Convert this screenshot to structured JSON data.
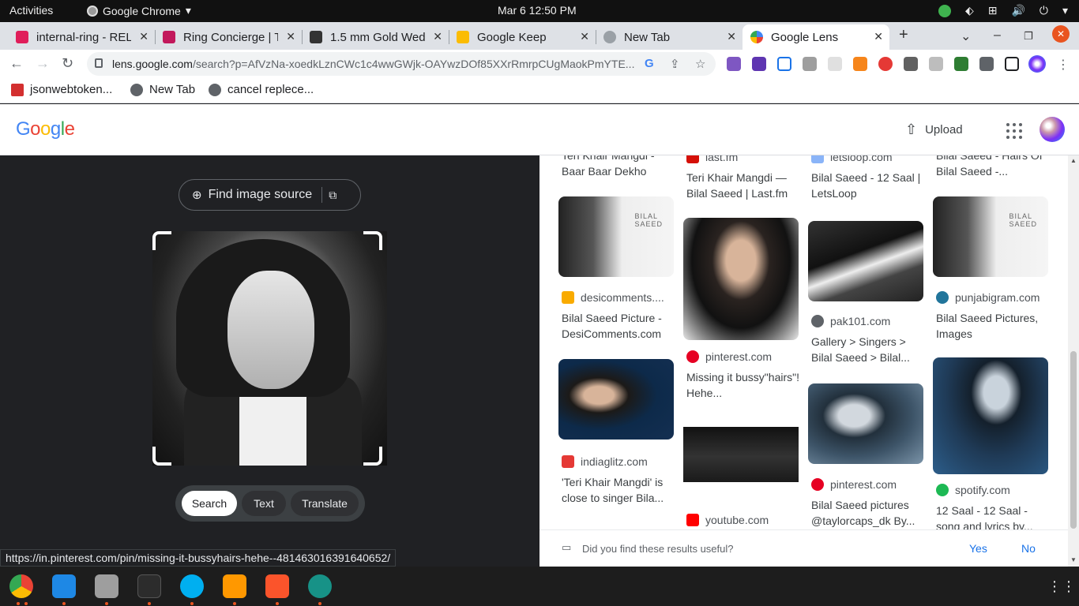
{
  "system": {
    "activities": "Activities",
    "app_name": "Google Chrome",
    "clock": "Mar 6  12:50 PM"
  },
  "tabs": [
    {
      "title": "internal-ring - REL",
      "favicon_color": "#e01e5a"
    },
    {
      "title": "Ring Concierge | T",
      "favicon_color": "#c2185b"
    },
    {
      "title": "1.5 mm Gold Wed",
      "favicon_color": "#333333"
    },
    {
      "title": "Google Keep",
      "favicon_color": "#fbbc04"
    },
    {
      "title": "New Tab",
      "favicon_color": "#9aa0a6"
    },
    {
      "title": "Google Lens",
      "favicon_color": "#4285f4",
      "active": true
    }
  ],
  "toolbar": {
    "url_host": "lens.google.com",
    "url_rest": "/search?p=AfVzNa-xoedkLznCWc1c4wwGWjk-OAYwzDOf85XXrRmrpCUgMaokPmYTE..."
  },
  "bookmarks": [
    {
      "label": "jsonwebtoken..."
    },
    {
      "label": "New Tab"
    },
    {
      "label": "cancel replece..."
    }
  ],
  "lens": {
    "logo": "Google",
    "upload": "Upload",
    "find_source": "Find image source",
    "modes": [
      "Search",
      "Text",
      "Translate"
    ],
    "status_url": "https://in.pinterest.com/pin/missing-it-bussyhairs-hehe--481463016391640652/"
  },
  "results": [
    {
      "col": 0,
      "source": "",
      "title": "Teri Khair Mangdi - Baar Baar Dekho",
      "partial": true
    },
    {
      "col": 1,
      "source": "last.fm",
      "title": "Teri Khair Mangdi — Bilal Saeed | Last.fm",
      "icon_color": "#d51007"
    },
    {
      "col": 2,
      "source": "letsloop.com",
      "title": "Bilal Saeed - 12 Saal | LetsLoop",
      "icon_color": "#8ab4f8"
    },
    {
      "col": 3,
      "source": "",
      "title": "Bilal Saeed - Hairs Of Bilal Saeed -...",
      "partial": true
    },
    {
      "col": 0,
      "source": "desicomments....",
      "title": "Bilal Saeed Picture - DesiComments.com",
      "icon_color": "#f9ab00"
    },
    {
      "col": 1,
      "source": "pinterest.com",
      "title": "Missing it bussy\"hairs\"! Hehe...",
      "icon_color": "#e60023"
    },
    {
      "col": 2,
      "source": "pak101.com",
      "title": "Gallery > Singers > Bilal Saeed > Bilal...",
      "icon_color": "#5f6368"
    },
    {
      "col": 3,
      "source": "punjabigram.com",
      "title": "Bilal Saeed Pictures, Images",
      "icon_color": "#21759b"
    },
    {
      "col": 0,
      "source": "indiaglitz.com",
      "title": "'Teri Khair Mangdi' is close to singer Bila...",
      "icon_color": "#e53935"
    },
    {
      "col": 1,
      "source": "youtube.com",
      "title": "",
      "icon_color": "#ff0000"
    },
    {
      "col": 2,
      "source": "pinterest.com",
      "title": "Bilal Saeed pictures @taylorcaps_dk By...",
      "icon_color": "#e60023"
    },
    {
      "col": 3,
      "source": "spotify.com",
      "title": "12 Saal - 12 Saal - song and lyrics by...",
      "icon_color": "#1db954"
    }
  ],
  "thumb_text": {
    "bilal_saeed": "BILAL\nSAEED"
  },
  "feedback": {
    "question": "Did you find these results useful?",
    "yes": "Yes",
    "no": "No"
  },
  "colors": {
    "accent_blue": "#1a73e8",
    "dark_bg": "#202124"
  }
}
